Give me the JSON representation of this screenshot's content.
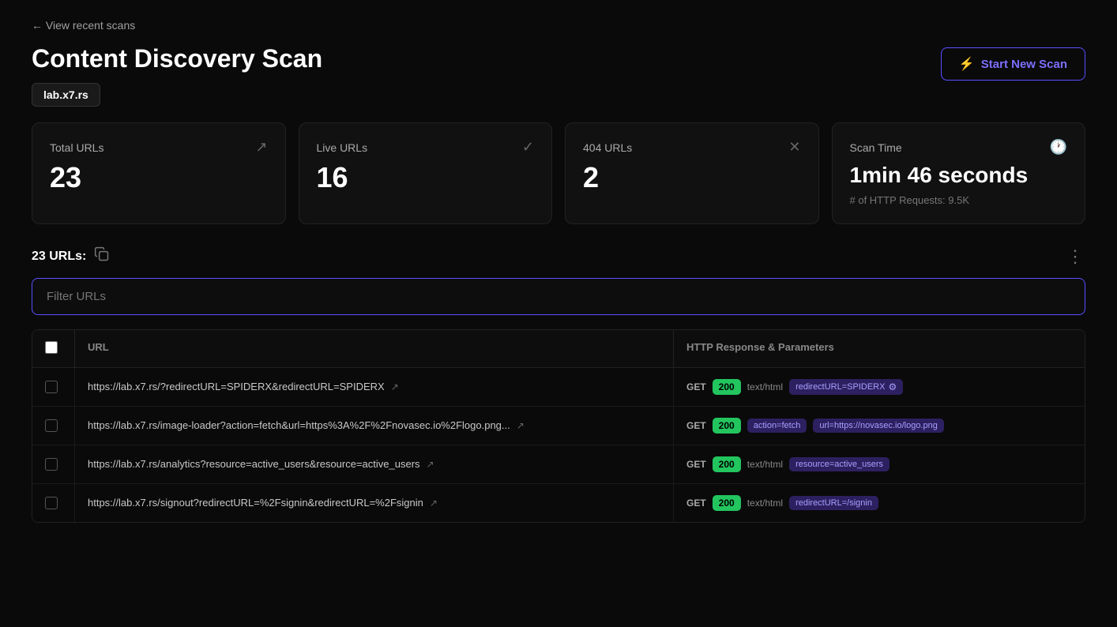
{
  "nav": {
    "back_label": "← View recent scans"
  },
  "header": {
    "title": "Content Discovery Scan",
    "domain": "lab.x7.rs",
    "start_scan_label": "Start New Scan"
  },
  "stats": [
    {
      "label": "Total URLs",
      "value": "23",
      "icon": "external-link",
      "sub": ""
    },
    {
      "label": "Live URLs",
      "value": "16",
      "icon": "check-circle",
      "sub": ""
    },
    {
      "label": "404 URLs",
      "value": "2",
      "icon": "x-circle",
      "sub": ""
    },
    {
      "label": "Scan Time",
      "value": "1min 46 seconds",
      "icon": "clock",
      "sub": "# of HTTP Requests: 9.5K"
    }
  ],
  "urls_section": {
    "label": "23 URLs:",
    "filter_placeholder": "Filter URLs",
    "table_headers": [
      "",
      "URL",
      "HTTP Response & Parameters"
    ]
  },
  "table_rows": [
    {
      "url": "https://lab.x7.rs/?redirectURL=SPIDERX&redirectURL=SPIDERX",
      "method": "GET",
      "status": "200",
      "content_type": "text/html",
      "params": [
        {
          "label": "redirectURL=SPIDERX",
          "has_icon": true
        }
      ]
    },
    {
      "url": "https://lab.x7.rs/image-loader?action=fetch&url=https%3A%2F%2Fnovasec.io%2Flogo.png...",
      "method": "GET",
      "status": "200",
      "content_type": "",
      "params": [
        {
          "label": "action=fetch",
          "has_icon": false
        },
        {
          "label": "url=https://novasec.io/logo.png",
          "has_icon": false
        }
      ]
    },
    {
      "url": "https://lab.x7.rs/analytics?resource=active_users&resource=active_users",
      "method": "GET",
      "status": "200",
      "content_type": "text/html",
      "params": [
        {
          "label": "resource=active_users",
          "has_icon": false
        }
      ]
    },
    {
      "url": "https://lab.x7.rs/signout?redirectURL=%2Fsignin&redirectURL=%2Fsignin",
      "method": "GET",
      "status": "200",
      "content_type": "text/html",
      "params": [
        {
          "label": "redirectURL=/signin",
          "has_icon": false
        }
      ]
    }
  ]
}
